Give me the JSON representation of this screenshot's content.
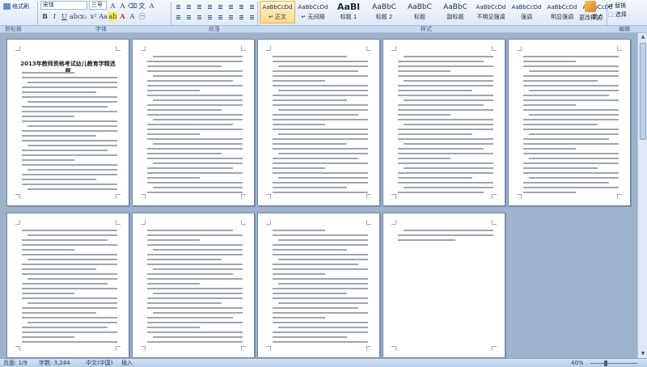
{
  "ribbon": {
    "clipboard": {
      "format_painter": "格式刷",
      "group": "剪贴板"
    },
    "font": {
      "family": "宋体",
      "size": "三号",
      "group": "字体"
    },
    "paragraph": {
      "group": "段落"
    },
    "styles": {
      "group": "样式",
      "items": [
        {
          "sample": "AaBbCcDd",
          "name": "↵ 正文",
          "active": true,
          "size": "small"
        },
        {
          "sample": "AaBbCcDd",
          "name": "↵ 无间隔",
          "active": false,
          "size": "small"
        },
        {
          "sample": "AaBl",
          "name": "标题 1",
          "active": false,
          "size": "big"
        },
        {
          "sample": "AaBbC",
          "name": "标题 2",
          "active": false,
          "size": "mid"
        },
        {
          "sample": "AaBbC",
          "name": "标题",
          "active": false,
          "size": "mid"
        },
        {
          "sample": "AaBbC",
          "name": "副标题",
          "active": false,
          "size": "mid"
        },
        {
          "sample": "AaBbCcDd",
          "name": "不明显强调",
          "active": false,
          "size": "small"
        },
        {
          "sample": "AaBbCcDd",
          "name": "强调",
          "active": false,
          "size": "small"
        },
        {
          "sample": "AaBbCcDd",
          "name": "明显强调",
          "active": false,
          "size": "small"
        },
        {
          "sample": "AaBbCcDd",
          "name": "要点",
          "active": false,
          "size": "small"
        }
      ],
      "change": "更改样式"
    },
    "editing": {
      "group": "编辑",
      "replace": "替换",
      "select": "选择"
    }
  },
  "document": {
    "title": "2013年教师资格考试幼儿教育学精选题"
  },
  "status": {
    "page": "页面: 1/9",
    "words": "字数: 3,244",
    "lang": "中文(中国)",
    "mode": "插入",
    "zoom": "40%"
  },
  "colors": {
    "accent": "#2b579a",
    "app_bg": "#abb9ce"
  }
}
